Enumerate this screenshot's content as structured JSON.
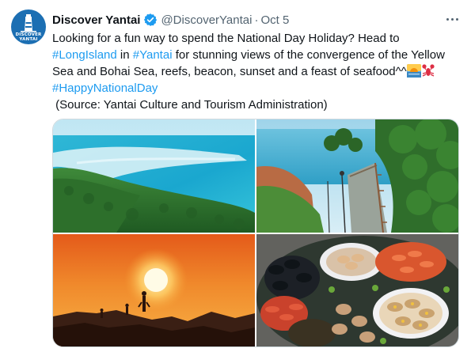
{
  "tweet": {
    "display_name": "Discover Yantai",
    "handle": "@DiscoverYantai",
    "separator": "·",
    "date": "Oct 5",
    "avatar_text_line1": "DISCOVER",
    "avatar_text_line2": "YANTAI",
    "verified_icon": "verified-badge",
    "body": {
      "line1": "Looking for a fun way to spend the National Day Holiday? Head to",
      "line2_tag1": "#LongIsland",
      "line2_mid": " in ",
      "line2_tag2": "#Yantai",
      "line2_rest": " for stunning views of the convergence of the Yellow",
      "line3": "Sea and Bohai Sea, reefs, beacon, sunset and a feast of seafood^^",
      "line3_emojis": [
        "sunrise-emoji",
        "lobster-emoji"
      ],
      "line4_tag": "#HappyNationalDay",
      "line5": " (Source: Yantai Culture and Tourism Administration)"
    },
    "media": [
      {
        "name": "sea-and-island-photo"
      },
      {
        "name": "coastal-walkway-photo"
      },
      {
        "name": "sunset-reef-photo"
      },
      {
        "name": "seafood-feast-photo"
      }
    ]
  },
  "colors": {
    "link": "#1d9bf0",
    "text": "#0f1419",
    "muted": "#536471",
    "avatar_bg": "#1c6fb3"
  }
}
